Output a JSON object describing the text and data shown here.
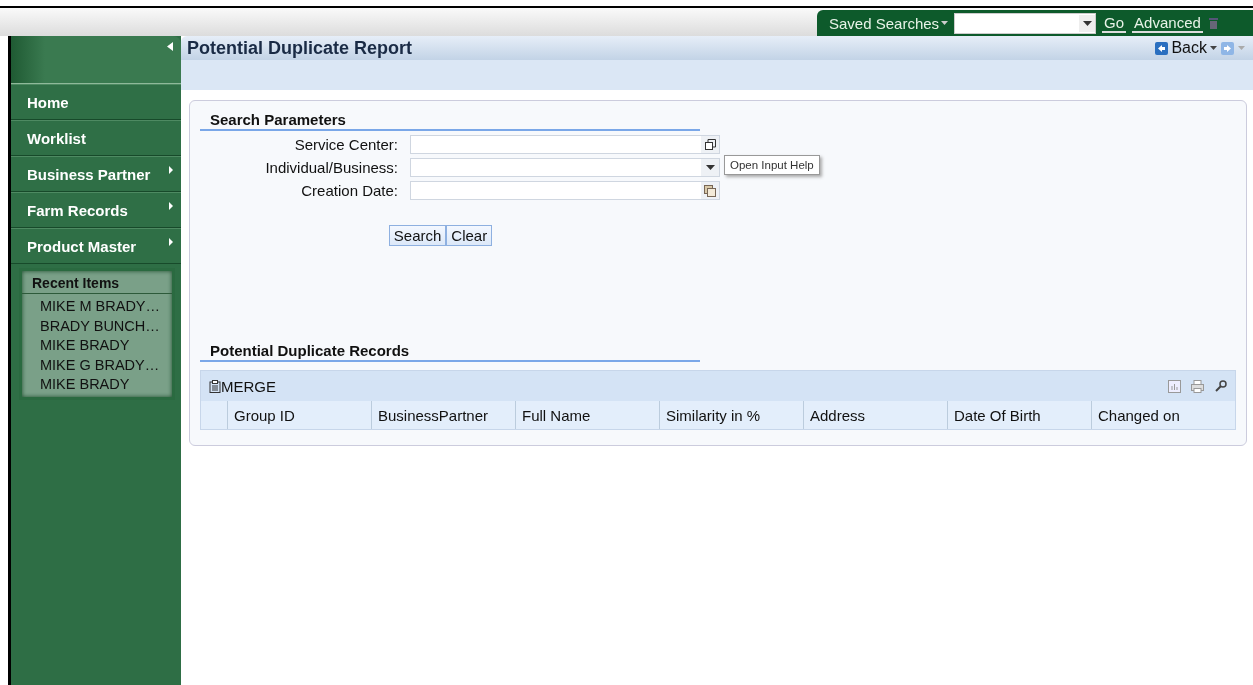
{
  "top_bar": {
    "saved_searches": "Saved Searches",
    "go": "Go",
    "advanced": "Advanced"
  },
  "sidebar": {
    "items": [
      {
        "label": "Home",
        "has_submenu": false
      },
      {
        "label": "Worklist",
        "has_submenu": false
      },
      {
        "label": "Business Partner",
        "has_submenu": true
      },
      {
        "label": "Farm Records",
        "has_submenu": true
      },
      {
        "label": "Product Master",
        "has_submenu": true
      }
    ],
    "recent_items": {
      "title": "Recent Items",
      "items": [
        "MIKE M BRADY…",
        "BRADY BUNCH…",
        "MIKE BRADY",
        "MIKE G BRADY…",
        "MIKE BRADY"
      ]
    }
  },
  "page": {
    "title": "Potential Duplicate Report",
    "back": "Back"
  },
  "search_parameters": {
    "title": "Search Parameters",
    "fields": [
      {
        "label": "Service Center:",
        "kind": "popup"
      },
      {
        "label": "Individual/Business:",
        "kind": "dropdown",
        "tooltip": "Open Input Help"
      },
      {
        "label": "Creation Date:",
        "kind": "date"
      }
    ],
    "buttons": [
      "Search",
      "Clear"
    ]
  },
  "records": {
    "title": "Potential Duplicate Records",
    "merge": "MERGE",
    "columns": [
      "Group ID",
      "BusinessPartner",
      "Full Name",
      "Similarity in %",
      "Address",
      "Date Of Birth",
      "Changed on"
    ]
  }
}
